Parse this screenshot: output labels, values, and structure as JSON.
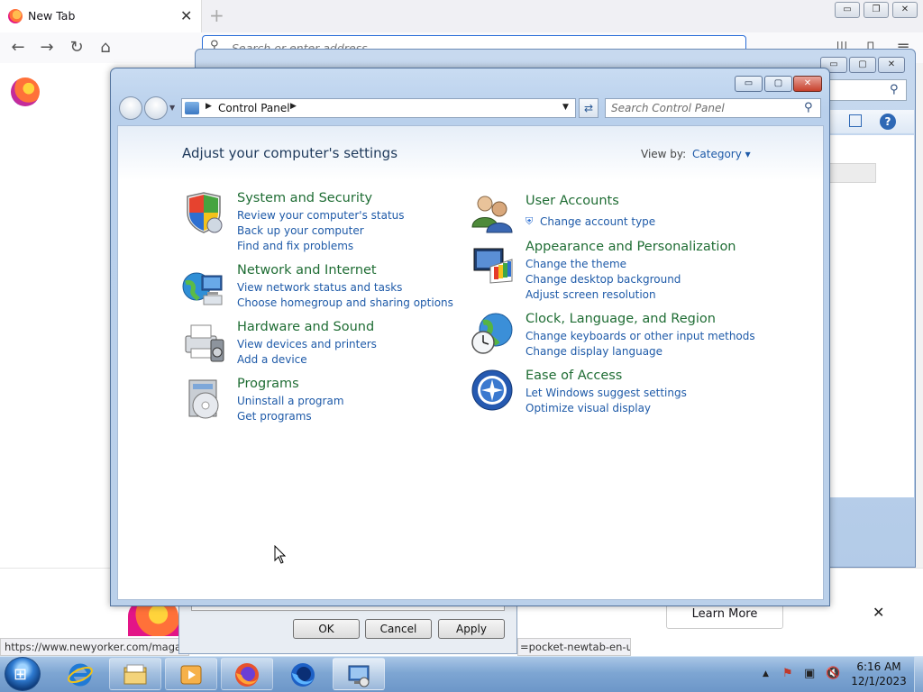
{
  "firefox": {
    "tab_title": "New Tab",
    "tab_close": "✕",
    "new_tab": "+",
    "url_placeholder": "Search or enter address",
    "learn_more": "Learn More",
    "banner_close": "✕",
    "status_url_left": "https://www.newyorker.com/magaz",
    "status_url_right": "=pocket-newtab-en-us",
    "win_buttons": [
      "▭",
      "❐",
      "✕"
    ],
    "nav_icons": [
      "←",
      "→",
      "↻",
      "⌂"
    ],
    "toolbar_icons": [
      "|||",
      "▯",
      "≡"
    ]
  },
  "background_dialog": {
    "ok": "OK",
    "cancel": "Cancel",
    "apply": "Apply"
  },
  "control_panel": {
    "window_buttons": [
      "▭",
      "▢",
      "✕"
    ],
    "address": {
      "path": "Control Panel",
      "separator": "▶",
      "dropdown": "▼"
    },
    "refresh_glyph": "⇄",
    "search": {
      "placeholder": "Search Control Panel",
      "icon": "⚲"
    },
    "heading": "Adjust your computer's settings",
    "view_by_label": "View by:",
    "view_by_value": "Category ▾",
    "categories": [
      {
        "title": "System and Security",
        "icon": "shield-icon",
        "links": [
          "Review your computer's status",
          "Back up your computer",
          "Find and fix problems"
        ]
      },
      {
        "title": "Network and Internet",
        "icon": "network-globe-icon",
        "links": [
          "View network status and tasks",
          "Choose homegroup and sharing options"
        ]
      },
      {
        "title": "Hardware and Sound",
        "icon": "printer-speaker-icon",
        "links": [
          "View devices and printers",
          "Add a device"
        ]
      },
      {
        "title": "Programs",
        "icon": "programs-disc-icon",
        "links": [
          "Uninstall a program",
          "Get programs"
        ]
      },
      {
        "title": "User Accounts",
        "icon": "users-icon",
        "links": [
          "Change account type"
        ]
      },
      {
        "title": "Appearance and Personalization",
        "icon": "monitor-palette-icon",
        "links": [
          "Change the theme",
          "Change desktop background",
          "Adjust screen resolution"
        ]
      },
      {
        "title": "Clock, Language, and Region",
        "icon": "globe-clock-icon",
        "links": [
          "Change keyboards or other input methods",
          "Change display language"
        ]
      },
      {
        "title": "Ease of Access",
        "icon": "ease-of-access-icon",
        "links": [
          "Let Windows suggest settings",
          "Optimize visual display"
        ]
      }
    ]
  },
  "taskbar": {
    "time": "6:16 AM",
    "date": "12/1/2023",
    "tray_icons": [
      "▲",
      "⚑",
      "▣",
      "🔇"
    ],
    "apps": [
      "internet-explorer-icon",
      "file-explorer-icon",
      "media-player-icon",
      "firefox-icon",
      "firefox-developer-icon",
      "control-panel-icon"
    ]
  },
  "colors": {
    "link": "#1e5aa8",
    "category_title": "#1f6d34",
    "window_frame": "#bad0ea",
    "taskbar": "#7ea6d3"
  }
}
